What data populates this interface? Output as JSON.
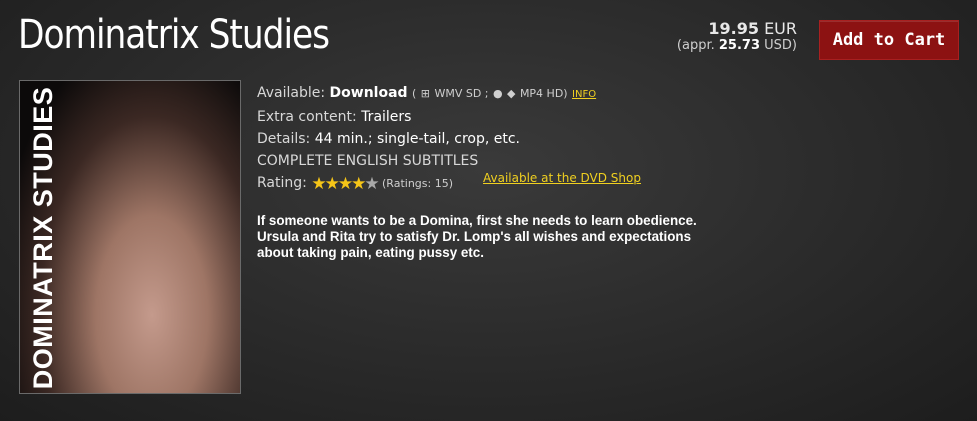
{
  "product": {
    "title": "Dominatrix Studies",
    "cover_text": "DOMINATRIX STUDIES"
  },
  "price": {
    "amount": "19.95",
    "currency": "EUR",
    "approx_prefix": "(appr.",
    "approx_amount": "25.73",
    "approx_suffix": "USD)"
  },
  "cart": {
    "label": "Add to Cart"
  },
  "info": {
    "available_label": "Available:",
    "available_value": "Download",
    "format_open": "(",
    "windows_icon": "windows-icon",
    "format_sd": "WMV SD ;",
    "apple_icon": "apple-icon",
    "android_icon": "android-icon",
    "format_hd": "MP4 HD)",
    "info_link": "INFO",
    "extra_label": "Extra content:",
    "extra_value": "Trailers",
    "details_label": "Details:",
    "details_value": "44 min.; single-tail, crop, etc.",
    "subtitles": "COMPLETE ENGLISH SUBTITLES",
    "rating_label": "Rating:",
    "rating_stars": 4,
    "rating_max": 5,
    "ratings_count": "(Ratings: 15)",
    "dvd_link": "Available at the DVD Shop"
  },
  "description": "If someone wants to be a Domina, first she needs to learn obedience. Ursula and Rita try to satisfy Dr. Lomp's all wishes and expectations about taking pain, eating pussy etc.",
  "colors": {
    "button_bg": "#8c1212",
    "link": "#f0d020",
    "star": "#f5c518"
  }
}
